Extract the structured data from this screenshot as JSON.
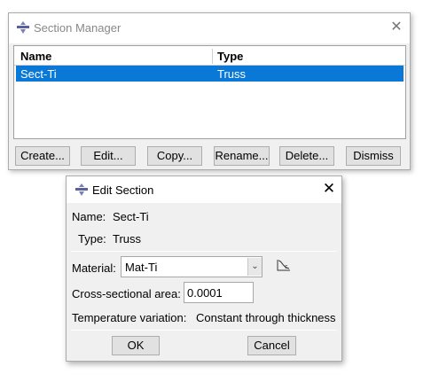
{
  "section_manager": {
    "title": "Section Manager",
    "columns": [
      "Name",
      "Type"
    ],
    "rows": [
      {
        "name": "Sect-Ti",
        "type": "Truss",
        "selected": true
      }
    ],
    "buttons": {
      "create": "Create...",
      "edit": "Edit...",
      "copy": "Copy...",
      "rename": "Rename...",
      "delete": "Delete...",
      "dismiss": "Dismiss"
    }
  },
  "edit_section": {
    "title": "Edit Section",
    "name_label": "Name:",
    "name_value": "Sect-Ti",
    "type_label": "Type:",
    "type_value": "Truss",
    "material_label": "Material:",
    "material_value": "Mat-Ti",
    "area_label": "Cross-sectional area:",
    "area_value": "0.0001",
    "temperature_label": "Temperature variation:",
    "temperature_value": "Constant through thickness",
    "ok_label": "OK",
    "cancel_label": "Cancel"
  },
  "colors": {
    "selection": "#0a78d7",
    "window_bg": "#f0f0f0",
    "button_bg": "#e1e1e1"
  },
  "icons": [
    "abaqus-app-icon",
    "close-icon",
    "chevron-down-icon",
    "create-material-icon"
  ]
}
